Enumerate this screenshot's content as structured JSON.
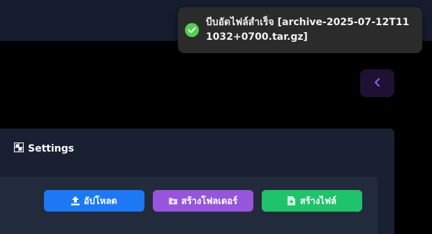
{
  "toast": {
    "message": "บีบอัดไฟล์สำเร็จ [archive-2025-07-12T111032+0700.tar.gz]",
    "icon": "check-circle-icon",
    "status_color": "#4cd34c"
  },
  "sidebar_toggle": {
    "icon": "chevron-left-icon",
    "accent": "#8b5cf6"
  },
  "card": {
    "title": "Settings",
    "title_icon": "settings-grid-icon"
  },
  "toolbar": {
    "upload_label": "อัปโหลด",
    "upload_icon": "upload-icon",
    "new_folder_label": "สร้างโฟลเดอร์",
    "new_folder_icon": "folder-plus-icon",
    "new_file_label": "สร้างไฟล์",
    "new_file_icon": "file-plus-icon"
  },
  "colors": {
    "upload": "#1c78f5",
    "new_folder": "#9655dc",
    "new_file": "#1fc36a"
  }
}
